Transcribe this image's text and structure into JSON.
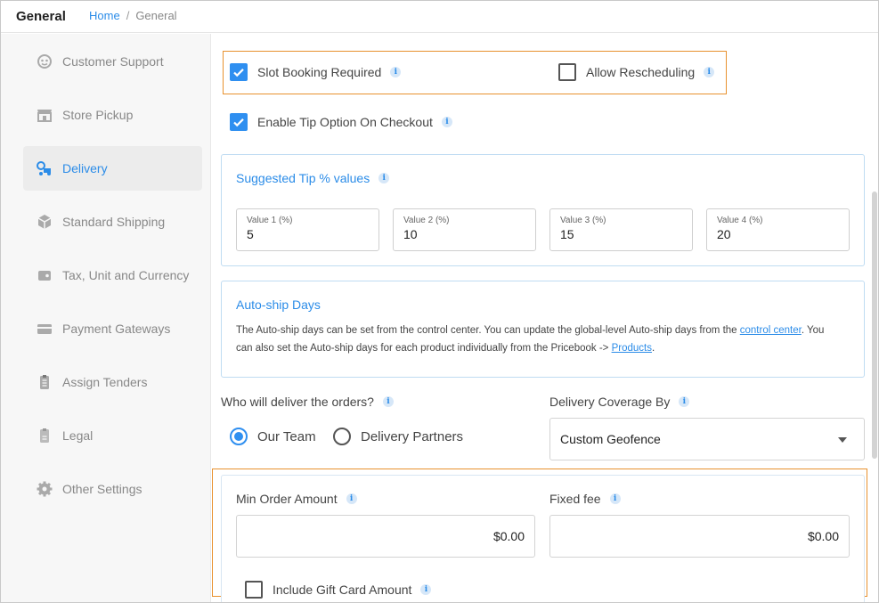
{
  "header": {
    "title": "General",
    "breadcrumb": {
      "home": "Home",
      "separator": "/",
      "current": "General"
    }
  },
  "sidebar": {
    "items": [
      {
        "label": "Customer Support",
        "icon": "headset-icon"
      },
      {
        "label": "Store Pickup",
        "icon": "store-icon"
      },
      {
        "label": "Delivery",
        "icon": "delivery-icon",
        "active": true
      },
      {
        "label": "Standard Shipping",
        "icon": "box-icon"
      },
      {
        "label": "Tax, Unit and Currency",
        "icon": "wallet-icon"
      },
      {
        "label": "Payment Gateways",
        "icon": "card-icon"
      },
      {
        "label": "Assign Tenders",
        "icon": "clipboard-icon"
      },
      {
        "label": "Legal",
        "icon": "document-icon"
      },
      {
        "label": "Other Settings",
        "icon": "gear-icon"
      }
    ]
  },
  "delivery": {
    "slot_booking": {
      "label": "Slot Booking Required",
      "checked": true
    },
    "allow_rescheduling": {
      "label": "Allow Rescheduling",
      "checked": false
    },
    "enable_tip": {
      "label": "Enable Tip Option On Checkout",
      "checked": true
    },
    "tips": {
      "title": "Suggested Tip % values",
      "fields": [
        {
          "label": "Value 1 (%)",
          "value": "5"
        },
        {
          "label": "Value 2 (%)",
          "value": "10"
        },
        {
          "label": "Value 3 (%)",
          "value": "15"
        },
        {
          "label": "Value 4 (%)",
          "value": "20"
        }
      ]
    },
    "autoship": {
      "title": "Auto-ship Days",
      "text_1": "The Auto-ship days can be set from the control center. You can update the global-level Auto-ship days from the ",
      "link_1": "control center",
      "text_2": ". You can also set the Auto-ship days for each product individually from the Pricebook -> ",
      "link_2": "Products",
      "text_3": "."
    },
    "who_delivers": {
      "label": "Who will deliver the orders?",
      "options": [
        "Our Team",
        "Delivery Partners"
      ],
      "selected": "Our Team"
    },
    "coverage": {
      "label": "Delivery Coverage By",
      "value": "Custom Geofence"
    },
    "min_order": {
      "label": "Min Order Amount",
      "value": "$0.00"
    },
    "fixed_fee": {
      "label": "Fixed fee",
      "value": "$0.00"
    },
    "include_gift_card": {
      "label": "Include Gift Card Amount",
      "checked": false
    }
  },
  "colors": {
    "accent": "#2b8ce8",
    "highlight": "#e8912e",
    "card_border": "#bfdcf2"
  }
}
